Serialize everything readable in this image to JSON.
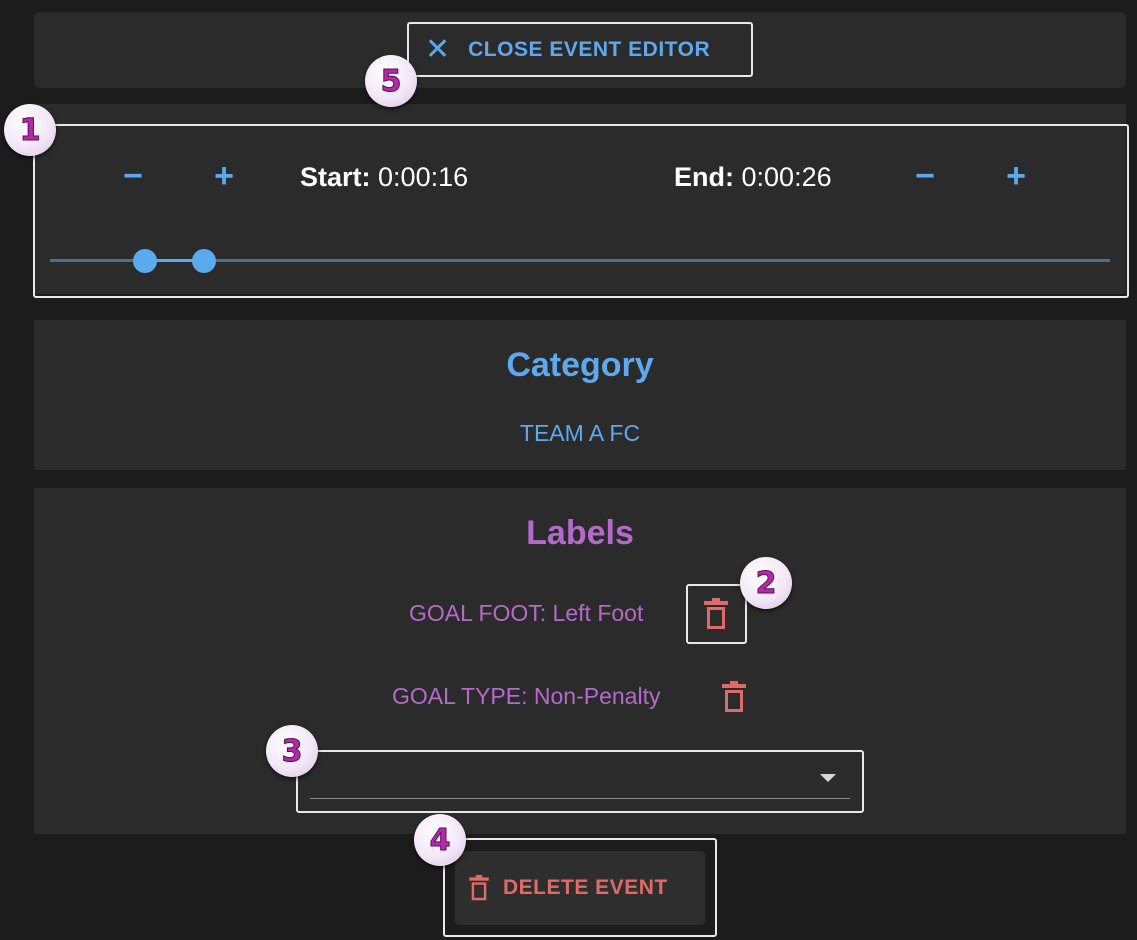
{
  "editor": {
    "close_label": "CLOSE EVENT EDITOR",
    "close_icon": "close-icon"
  },
  "time": {
    "start_label": "Start:",
    "start_value": "0:00:16",
    "end_label": "End:",
    "end_value": "0:00:26",
    "decrement": "−",
    "increment": "+",
    "slider_start_fraction": 0.09,
    "slider_end_fraction": 0.145
  },
  "category": {
    "title": "Category",
    "value": "TEAM A FC"
  },
  "labels": {
    "title": "Labels",
    "items": [
      {
        "text": "GOAL FOOT: Left Foot",
        "icon": "trash-icon"
      },
      {
        "text": "GOAL TYPE: Non-Penalty",
        "icon": "trash-icon"
      }
    ],
    "select_value": ""
  },
  "delete": {
    "label": "DELETE EVENT",
    "icon": "trash-icon"
  },
  "annotations": [
    "1",
    "2",
    "3",
    "4",
    "5"
  ],
  "colors": {
    "accent_blue": "#5ba9ee",
    "label_purple": "#b56acb",
    "danger_red": "#e06a6a",
    "panel_bg": "#2b2b2b",
    "page_bg": "#1c1c1c"
  }
}
